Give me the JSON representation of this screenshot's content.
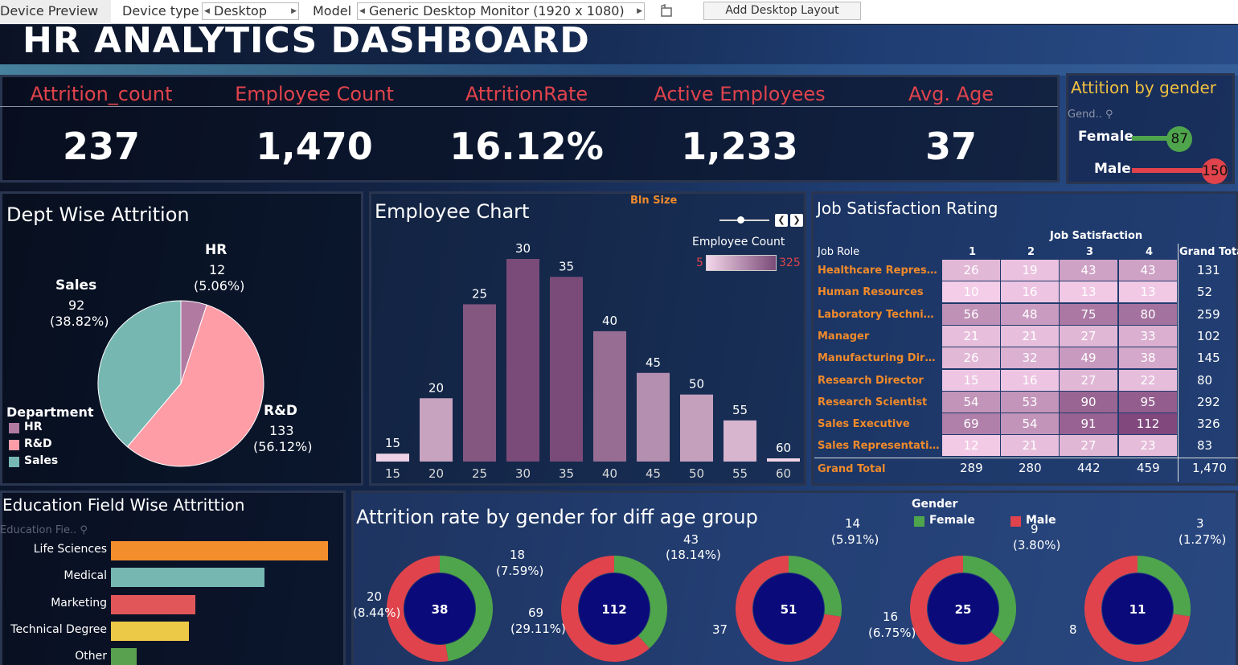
{
  "toolbar": {
    "device_preview": "Device Preview",
    "device_type_label": "Device type",
    "device_type_value": "Desktop",
    "model_label": "Model",
    "model_value": "Generic Desktop Monitor (1920 x 1080)",
    "add_layout": "Add Desktop Layout"
  },
  "dashboard": {
    "title": "HR ANALYTICS DASHBOARD"
  },
  "kpis": [
    {
      "label": "Attrition_count",
      "value": "237"
    },
    {
      "label": "Employee Count",
      "value": "1,470"
    },
    {
      "label": "AttritionRate",
      "value": "16.12%"
    },
    {
      "label": "Active Employees",
      "value": "1,233"
    },
    {
      "label": "Avg. Age",
      "value": "37"
    }
  ],
  "gender_panel": {
    "title": "Attition by gender",
    "filter_label": "Gend..",
    "rows": [
      {
        "label": "Female",
        "value": "87",
        "color": "#4fa54b"
      },
      {
        "label": "Male",
        "value": "150",
        "color": "#e0434c"
      }
    ]
  },
  "dept_panel": {
    "title": "Dept Wise Attrition",
    "legend_title": "Department",
    "legend": [
      {
        "name": "HR",
        "color": "#b07aa1"
      },
      {
        "name": "R&D",
        "color": "#ff9da7"
      },
      {
        "name": "Sales",
        "color": "#76b7b2"
      }
    ],
    "labels": [
      {
        "name": "HR",
        "count": "12",
        "pct": "(5.06%)"
      },
      {
        "name": "Sales",
        "count": "92",
        "pct": "(38.82%)"
      },
      {
        "name": "R&D",
        "count": "133",
        "pct": "(56.12%)"
      }
    ]
  },
  "employee_panel": {
    "title": "Employee Chart",
    "bin_label": "Bln Size",
    "legend_title": "Employee Count",
    "legend_min": "5",
    "legend_max": "325"
  },
  "job_panel": {
    "title": "Job Satisfaction Rating",
    "col_header": "Job Satisfaction",
    "row_header": "Job Role",
    "grand_total_label": "Grand Total",
    "columns": [
      "1",
      "2",
      "3",
      "4"
    ],
    "rows": [
      {
        "role": "Healthcare Representat..",
        "vals": [
          "26",
          "19",
          "43",
          "43"
        ],
        "total": "131"
      },
      {
        "role": "Human Resources",
        "vals": [
          "10",
          "16",
          "13",
          "13"
        ],
        "total": "52"
      },
      {
        "role": "Laboratory Technician",
        "vals": [
          "56",
          "48",
          "75",
          "80"
        ],
        "total": "259"
      },
      {
        "role": "Manager",
        "vals": [
          "21",
          "21",
          "27",
          "33"
        ],
        "total": "102"
      },
      {
        "role": "Manufacturing Director",
        "vals": [
          "26",
          "32",
          "49",
          "38"
        ],
        "total": "145"
      },
      {
        "role": "Research Director",
        "vals": [
          "15",
          "16",
          "27",
          "22"
        ],
        "total": "80"
      },
      {
        "role": "Research Scientist",
        "vals": [
          "54",
          "53",
          "90",
          "95"
        ],
        "total": "292"
      },
      {
        "role": "Sales Executive",
        "vals": [
          "69",
          "54",
          "91",
          "112"
        ],
        "total": "326"
      },
      {
        "role": "Sales Representative",
        "vals": [
          "12",
          "21",
          "27",
          "23"
        ],
        "total": "83"
      }
    ],
    "grand_totals": [
      "289",
      "280",
      "442",
      "459"
    ],
    "grand_total_all": "1,470"
  },
  "education_panel": {
    "title": "Education Field Wise Attrittion",
    "filter_label": "Education Fie..",
    "bars": [
      {
        "label": "Life Sciences",
        "share": 1.0,
        "color": "#f28e2b"
      },
      {
        "label": "Medical",
        "share": 0.709,
        "color": "#76b7b2"
      },
      {
        "label": "Marketing",
        "share": 0.388,
        "color": "#e15759"
      },
      {
        "label": "Technical Degree",
        "share": 0.359,
        "color": "#edc948"
      },
      {
        "label": "Other",
        "share": 0.12,
        "color": "#59a14f"
      }
    ]
  },
  "age_panel": {
    "title": "Attrition rate by gender for diff age group",
    "legend_title": "Gender",
    "legend": [
      {
        "name": "Female",
        "color": "#4fa54b"
      },
      {
        "name": "Male",
        "color": "#e0434c"
      }
    ],
    "donuts": [
      {
        "center": "38",
        "female_share": 0.474
      },
      {
        "center": "112",
        "female_share": 0.384
      },
      {
        "center": "51",
        "female_share": 0.274
      },
      {
        "center": "25",
        "female_share": 0.36
      },
      {
        "center": "11",
        "female_share": 0.273
      }
    ],
    "labels": [
      "18",
      "(7.59%)",
      "20",
      "(8.44%)",
      "43",
      "(18.14%)",
      "69",
      "(29.11%)",
      "14",
      "(5.91%)",
      "37",
      "9",
      "(3.80%)",
      "16",
      "(6.75%)",
      "3",
      "(1.27%)",
      "8"
    ]
  },
  "chart_data": [
    {
      "type": "pie",
      "title": "Dept Wise Attrition",
      "categories": [
        "HR",
        "R&D",
        "Sales"
      ],
      "values": [
        12,
        133,
        92
      ],
      "percent": [
        5.06,
        56.12,
        38.82
      ]
    },
    {
      "type": "bar",
      "title": "Employee Chart",
      "categories": [
        "15",
        "20",
        "25",
        "30",
        "35",
        "40",
        "45",
        "50",
        "55",
        "60"
      ],
      "values": [
        15,
        120,
        298,
        384,
        350,
        247,
        168,
        127,
        78,
        5
      ],
      "bar_labels": [
        "15",
        "20",
        "25",
        "30",
        "35",
        "40",
        "45",
        "50",
        "55",
        "60"
      ]
    },
    {
      "type": "heatmap",
      "title": "Job Satisfaction Rating",
      "x": [
        "1",
        "2",
        "3",
        "4"
      ],
      "y": [
        "Healthcare Representat..",
        "Human Resources",
        "Laboratory Technician",
        "Manager",
        "Manufacturing Director",
        "Research Director",
        "Research Scientist",
        "Sales Executive",
        "Sales Representative"
      ],
      "values": [
        [
          26,
          19,
          43,
          43
        ],
        [
          10,
          16,
          13,
          13
        ],
        [
          56,
          48,
          75,
          80
        ],
        [
          21,
          21,
          27,
          33
        ],
        [
          26,
          32,
          49,
          38
        ],
        [
          15,
          16,
          27,
          22
        ],
        [
          54,
          53,
          90,
          95
        ],
        [
          69,
          54,
          91,
          112
        ],
        [
          12,
          21,
          27,
          23
        ]
      ]
    },
    {
      "type": "bar",
      "title": "Education Field Wise Attrittion",
      "categories": [
        "Life Sciences",
        "Medical",
        "Marketing",
        "Technical Degree",
        "Other"
      ],
      "values": [
        89,
        63,
        35,
        32,
        11
      ]
    }
  ]
}
